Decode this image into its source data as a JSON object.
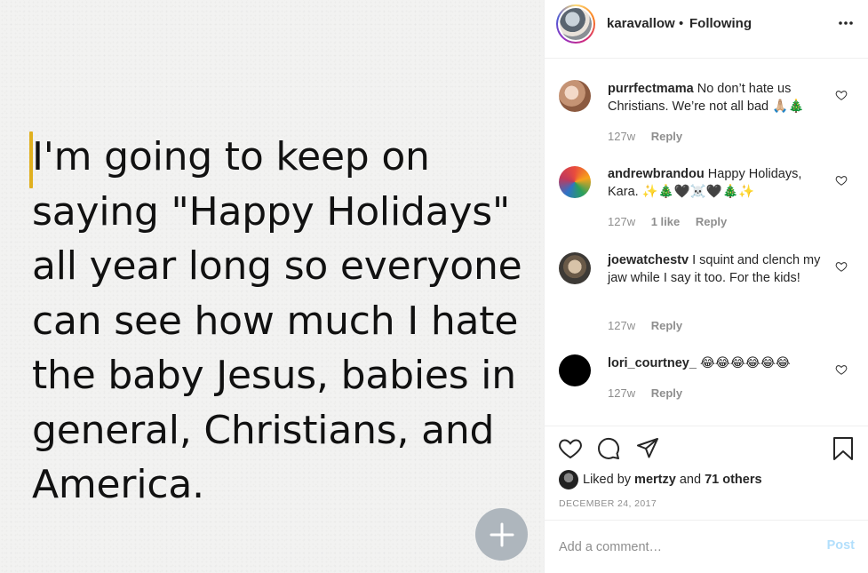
{
  "post_image": {
    "lines": [
      "I'm going to keep on",
      "saying \"Happy Holidays\"",
      "all year long so everyone",
      "can see how much I hate",
      "the baby Jesus, babies in",
      "general, Christians, and",
      "America."
    ],
    "cursor_color": "#e0b01f",
    "add_button_icon": "plus-icon"
  },
  "header": {
    "username": "karavallow",
    "separator": "•",
    "follow_status": "Following",
    "more_icon": "more-icon"
  },
  "comments": [
    {
      "username": "purrfectmama",
      "text": "No don’t hate us Christians. We’re not all bad 🙏🏼🎄",
      "age": "127w",
      "likes": "",
      "reply": "Reply"
    },
    {
      "username": "andrewbrandou",
      "text": "Happy Holidays, Kara. ✨🎄🖤☠️🖤🎄✨",
      "age": "127w",
      "likes": "1 like",
      "reply": "Reply"
    },
    {
      "username": "joewatchestv",
      "text": "I squint and clench my jaw while I say it too. For the kids!",
      "age": "127w",
      "likes": "",
      "reply": "Reply"
    },
    {
      "username": "lori_courtney_",
      "text": "😂😂😂😂😂😂",
      "age": "127w",
      "likes": "",
      "reply": "Reply"
    }
  ],
  "actions": {
    "liked_prefix": "Liked by",
    "liked_user": "mertzy",
    "liked_and": "and",
    "liked_others": "71 others",
    "date": "DECEMBER 24, 2017"
  },
  "add_comment": {
    "placeholder": "Add a comment…",
    "post_label": "Post",
    "post_color": "#b2dffc"
  }
}
